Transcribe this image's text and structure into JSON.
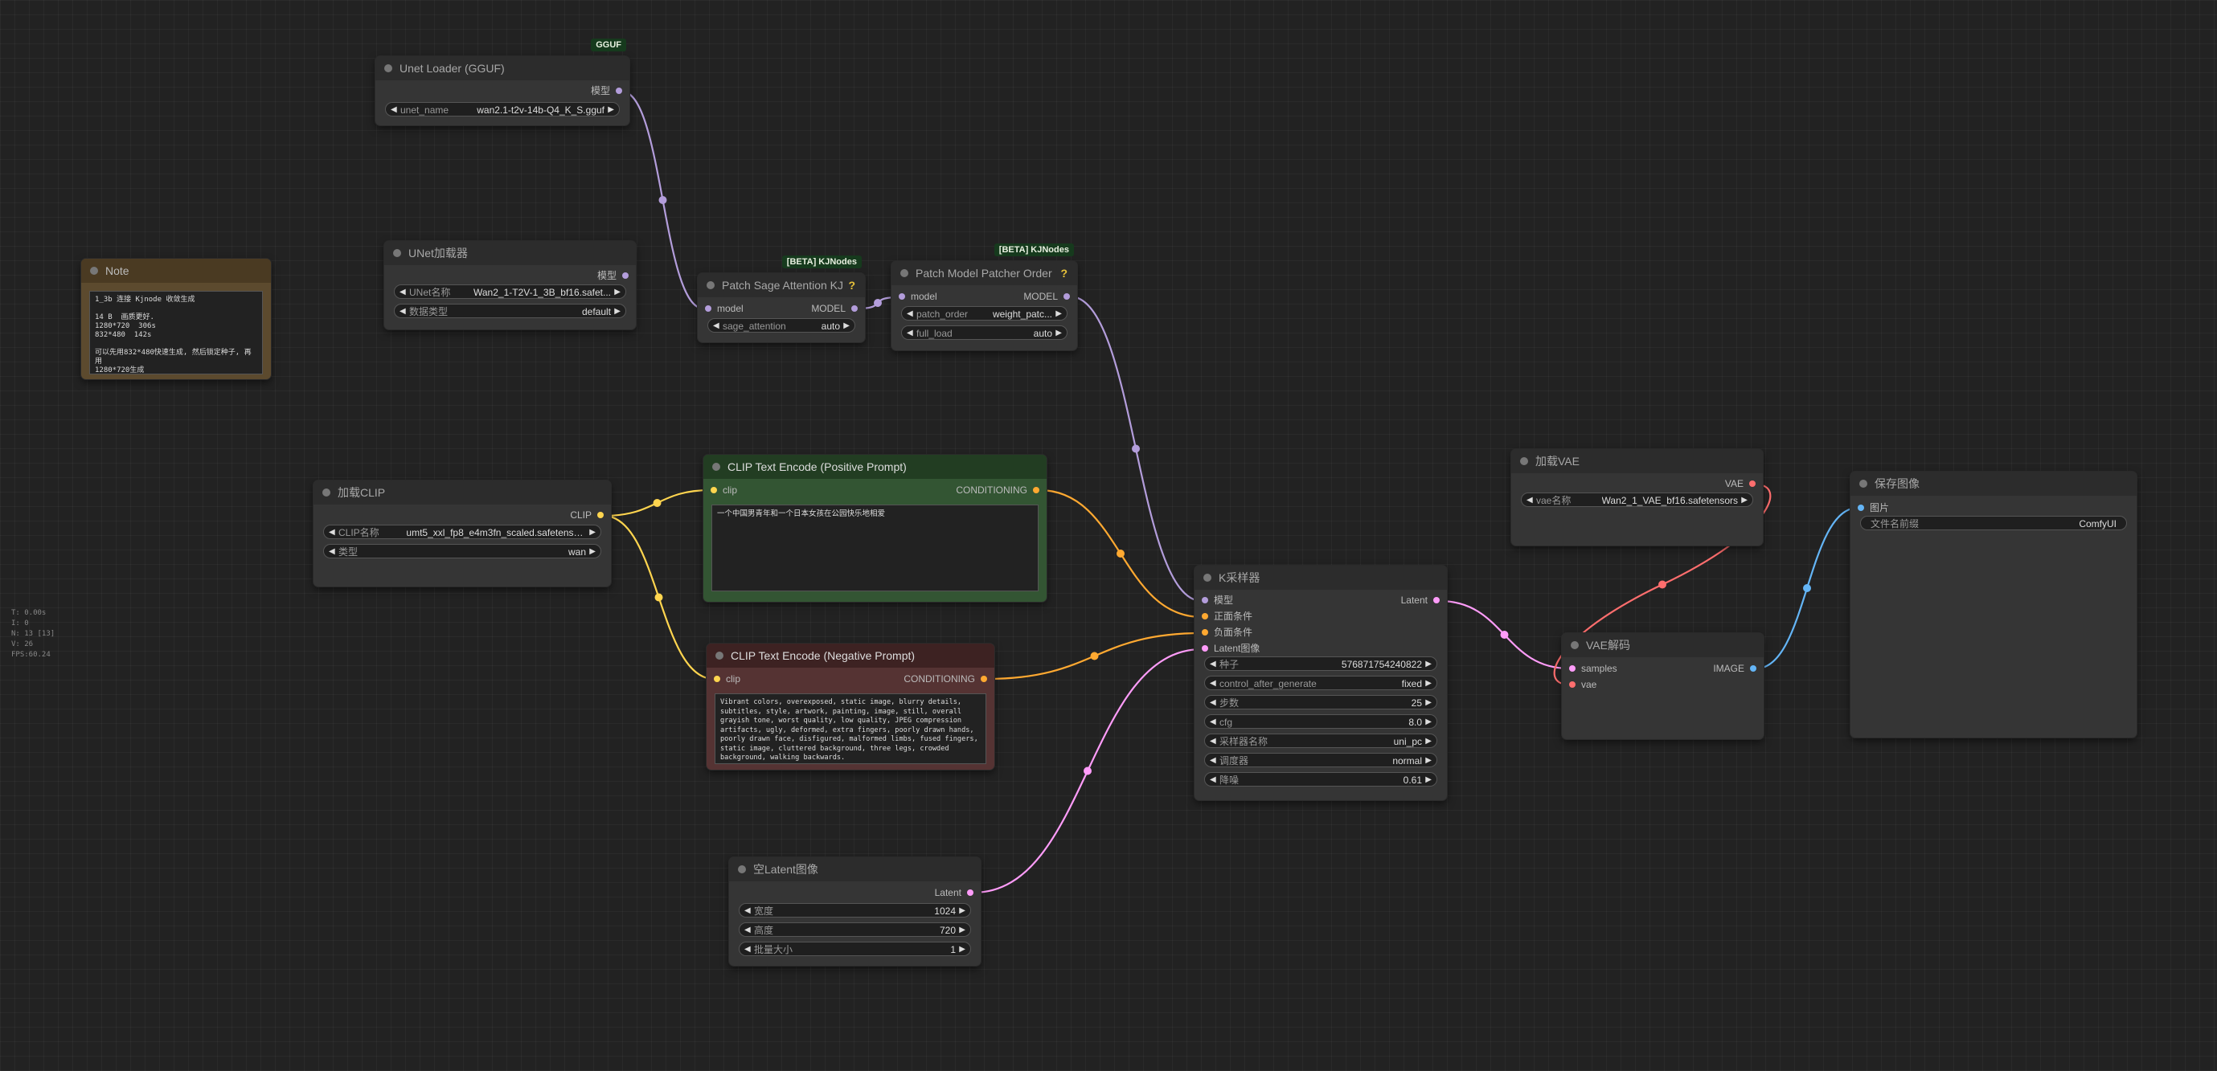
{
  "colors": {
    "model": "#b39ddb",
    "clip": "#ffd54f",
    "conditioning": "#ffa931",
    "latent": "#ff9cf9",
    "vae": "#ff6e6e",
    "image": "#64b5f6"
  },
  "nodes": {
    "unet_gguf": {
      "badge": "GGUF",
      "title": "Unet Loader (GGUF)",
      "out": "模型",
      "widgets": [
        {
          "label": "unet_name",
          "value": "wan2.1-t2v-14b-Q4_K_S.gguf"
        }
      ]
    },
    "unet": {
      "title": "UNet加载器",
      "out": "模型",
      "widgets": [
        {
          "label": "UNet名称",
          "value": "Wan2_1-T2V-1_3B_bf16.safet..."
        },
        {
          "label": "数据类型",
          "value": "default"
        }
      ]
    },
    "note": {
      "title": "Note",
      "text": "1_3b 连接 Kjnode 收敛生成\n\n14 B  画质更好.\n1280*720  306s\n832*480  142s\n\n可以先用832*480快速生成, 然后锁定种子, 再用\n1280*720生成"
    },
    "sage": {
      "badge": "[BETA] KJNodes",
      "title": "Patch Sage Attention KJ",
      "help": "?",
      "in": "model",
      "out": "MODEL",
      "widgets": [
        {
          "label": "sage_attention",
          "value": "auto"
        }
      ]
    },
    "patcher": {
      "badge": "[BETA] KJNodes",
      "title": "Patch Model Patcher Order",
      "help": "?",
      "in": "model",
      "out": "MODEL",
      "widgets": [
        {
          "label": "patch_order",
          "value": "weight_patc..."
        },
        {
          "label": "full_load",
          "value": "auto"
        }
      ]
    },
    "clip_loader": {
      "title": "加载CLIP",
      "out": "CLIP",
      "widgets": [
        {
          "label": "CLIP名称",
          "value": "umt5_xxl_fp8_e4m3fn_scaled.safetensors"
        },
        {
          "label": "类型",
          "value": "wan"
        }
      ]
    },
    "pos": {
      "title": "CLIP Text Encode (Positive Prompt)",
      "in": "clip",
      "out": "CONDITIONING",
      "text": "一个中国男青年和一个日本女孩在公园快乐地相爱"
    },
    "neg": {
      "title": "CLIP Text Encode (Negative Prompt)",
      "in": "clip",
      "out": "CONDITIONING",
      "text": "Vibrant colors, overexposed, static image, blurry details, subtitles, style, artwork, painting, image, still, overall grayish tone, worst quality, low quality, JPEG compression artifacts, ugly, deformed, extra fingers, poorly drawn hands, poorly drawn face, disfigured, malformed limbs, fused fingers, static image, cluttered background, three legs, crowded background, walking backwards."
    },
    "latent": {
      "title": "空Latent图像",
      "out": "Latent",
      "widgets": [
        {
          "label": "宽度",
          "value": "1024"
        },
        {
          "label": "高度",
          "value": "720"
        },
        {
          "label": "批量大小",
          "value": "1"
        }
      ]
    },
    "ksampler": {
      "title": "K采样器",
      "out": "Latent",
      "inputs": [
        "模型",
        "正面条件",
        "负面条件",
        "Latent图像"
      ],
      "widgets": [
        {
          "label": "种子",
          "value": "576871754240822"
        },
        {
          "label": "control_after_generate",
          "value": "fixed"
        },
        {
          "label": "步数",
          "value": "25"
        },
        {
          "label": "cfg",
          "value": "8.0"
        },
        {
          "label": "采样器名称",
          "value": "uni_pc"
        },
        {
          "label": "调度器",
          "value": "normal"
        },
        {
          "label": "降噪",
          "value": "0.61"
        }
      ]
    },
    "vae_loader": {
      "title": "加载VAE",
      "out": "VAE",
      "widgets": [
        {
          "label": "vae名称",
          "value": "Wan2_1_VAE_bf16.safetensors"
        }
      ]
    },
    "vae_decode": {
      "title": "VAE解码",
      "inputs": [
        "samples",
        "vae"
      ],
      "out": "IMAGE"
    },
    "save": {
      "title": "保存图像",
      "in": "图片",
      "widgets": [
        {
          "label": "文件名前缀",
          "value": "ComfyUI"
        }
      ]
    }
  },
  "stats": [
    "T: 0.00s",
    "I: 0",
    "N: 13 [13]",
    "V: 26",
    "FPS:60.24"
  ]
}
